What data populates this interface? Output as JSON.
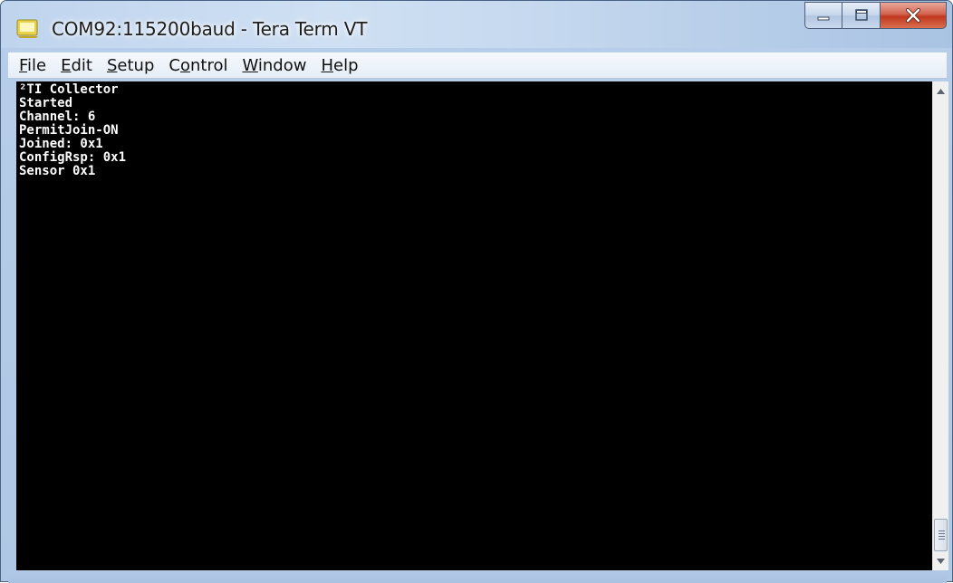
{
  "window": {
    "title": "COM92:115200baud - Tera Term VT",
    "colors": {
      "terminal_bg": "#000000",
      "terminal_fg": "#ffffff",
      "close_button": "#c7432a"
    }
  },
  "icons": {
    "app": "tera-term-icon",
    "minimize": "minimize-icon",
    "maximize": "maximize-icon",
    "close": "close-icon",
    "scroll_up": "scroll-up-arrow-icon",
    "scroll_down": "scroll-down-arrow-icon"
  },
  "menu": {
    "file": {
      "mnemonic": "F",
      "rest": "ile"
    },
    "edit": {
      "mnemonic": "E",
      "rest": "dit"
    },
    "setup": {
      "mnemonic": "S",
      "rest": "etup"
    },
    "control": {
      "pre": "C",
      "mnemonic": "o",
      "rest": "ntrol"
    },
    "window": {
      "mnemonic": "W",
      "rest": "indow"
    },
    "help": {
      "mnemonic": "H",
      "rest": "elp"
    }
  },
  "terminal": {
    "lines": [
      "²TI Collector",
      "Started",
      "Channel: 6",
      "PermitJoin-ON",
      "Joined: 0x1",
      "ConfigRsp: 0x1",
      "Sensor 0x1"
    ]
  }
}
